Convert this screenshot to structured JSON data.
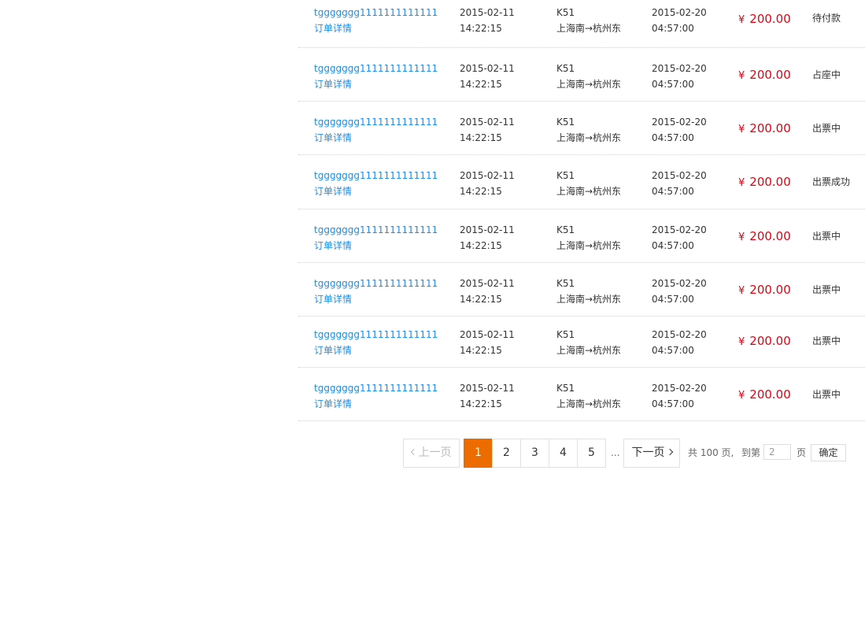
{
  "orders": [
    {
      "order_no": "tggggggg1111111111111",
      "detail_label": "订单详情",
      "created_date": "2015-02-11",
      "created_time": "14:22:15",
      "train": "K51",
      "route": "上海南→杭州东",
      "depart_date": "2015-02-20",
      "depart_time": "04:57:00",
      "price_symbol": "¥",
      "price": "200.00",
      "status": "待付款"
    },
    {
      "order_no": "tggggggg1111111111111",
      "detail_label": "订单详情",
      "created_date": "2015-02-11",
      "created_time": "14:22:15",
      "train": "K51",
      "route": "上海南→杭州东",
      "depart_date": "2015-02-20",
      "depart_time": "04:57:00",
      "price_symbol": "¥",
      "price": "200.00",
      "status": "占座中"
    },
    {
      "order_no": "tggggggg1111111111111",
      "detail_label": "订单详情",
      "created_date": "2015-02-11",
      "created_time": "14:22:15",
      "train": "K51",
      "route": "上海南→杭州东",
      "depart_date": "2015-02-20",
      "depart_time": "04:57:00",
      "price_symbol": "¥",
      "price": "200.00",
      "status": "出票中"
    },
    {
      "order_no": "tggggggg1111111111111",
      "detail_label": "订单详情",
      "created_date": "2015-02-11",
      "created_time": "14:22:15",
      "train": "K51",
      "route": "上海南→杭州东",
      "depart_date": "2015-02-20",
      "depart_time": "04:57:00",
      "price_symbol": "¥",
      "price": "200.00",
      "status": "出票成功"
    },
    {
      "order_no": "tggggggg1111111111111",
      "detail_label": "订单详情",
      "created_date": "2015-02-11",
      "created_time": "14:22:15",
      "train": "K51",
      "route": "上海南→杭州东",
      "depart_date": "2015-02-20",
      "depart_time": "04:57:00",
      "price_symbol": "¥",
      "price": "200.00",
      "status": "出票中"
    },
    {
      "order_no": "tggggggg1111111111111",
      "detail_label": "订单详情",
      "created_date": "2015-02-11",
      "created_time": "14:22:15",
      "train": "K51",
      "route": "上海南→杭州东",
      "depart_date": "2015-02-20",
      "depart_time": "04:57:00",
      "price_symbol": "¥",
      "price": "200.00",
      "status": "出票中"
    },
    {
      "order_no": "tggggggg1111111111111",
      "detail_label": "订单详情",
      "created_date": "2015-02-11",
      "created_time": "14:22:15",
      "train": "K51",
      "route": "上海南→杭州东",
      "depart_date": "2015-02-20",
      "depart_time": "04:57:00",
      "price_symbol": "¥",
      "price": "200.00",
      "status": "出票中"
    },
    {
      "order_no": "tggggggg1111111111111",
      "detail_label": "订单详情",
      "created_date": "2015-02-11",
      "created_time": "14:22:15",
      "train": "K51",
      "route": "上海南→杭州东",
      "depart_date": "2015-02-20",
      "depart_time": "04:57:00",
      "price_symbol": "¥",
      "price": "200.00",
      "status": "出票中"
    }
  ],
  "pagination": {
    "prev_label": "上一页",
    "next_label": "下一页",
    "pages": [
      "1",
      "2",
      "3",
      "4",
      "5"
    ],
    "current_page": "1",
    "ellipsis": "...",
    "total_text": "共 100 页,",
    "goto_prefix": "到第",
    "goto_value": "2",
    "goto_suffix": "页",
    "confirm_label": "确定"
  },
  "colors": {
    "link": "#1a8ee8",
    "price": "#e60012",
    "active_page": "#ec6c00"
  }
}
